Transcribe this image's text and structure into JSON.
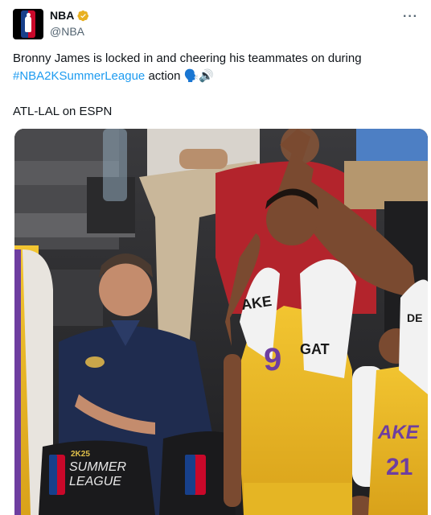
{
  "account": {
    "display_name": "NBA",
    "handle": "@NBA",
    "avatar_icon": "nba-logo-icon",
    "verified_color": "#e8b020"
  },
  "menu": {
    "more_label": "···"
  },
  "tweet": {
    "line1": "Bronny James is locked in and cheering his teammates on during",
    "hashtag": "#NBA2KSummerLeague",
    "after_hashtag": "action",
    "emoji": "🗣️🔊",
    "line3": "ATL-LAL on ESPN",
    "link_color": "#1d9bf0"
  },
  "media": {
    "jersey_number": "9",
    "towel_text_1": "AKE",
    "towel_text_2": "GAT",
    "jersey_text_right": "AKE",
    "jersey_number_right": "21",
    "chair_logo_year": "2K25",
    "chair_logo_line1": "SUMMER",
    "chair_logo_line2": "LEAGUE",
    "towel_edge_text": "DE"
  }
}
